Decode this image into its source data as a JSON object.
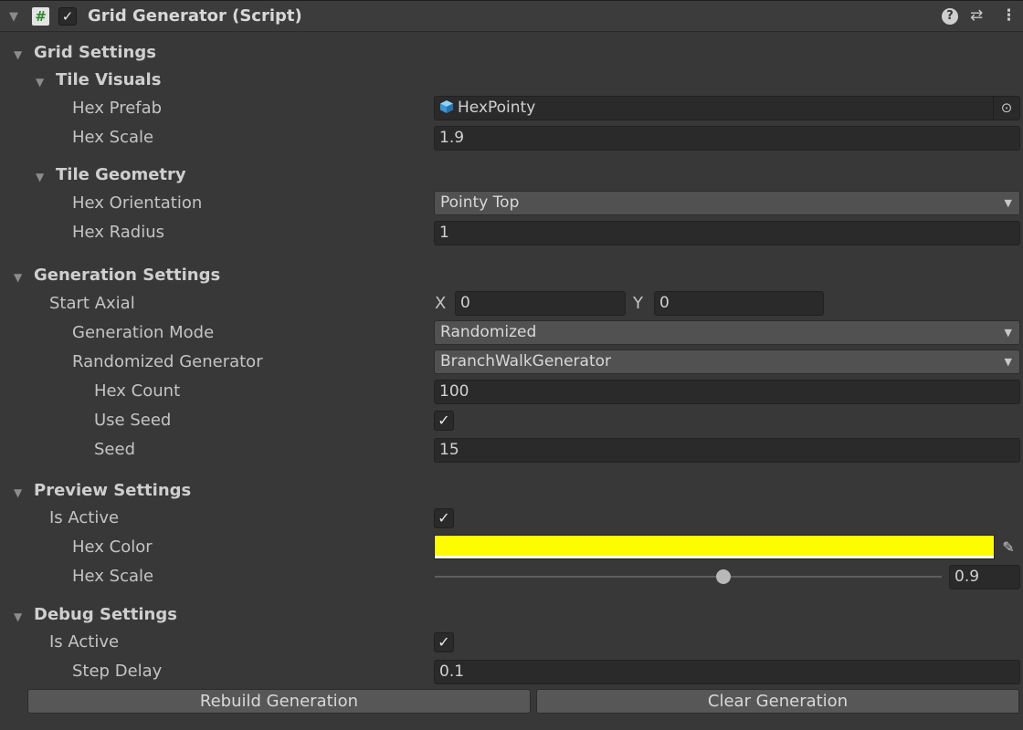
{
  "header": {
    "title": "Grid Generator (Script)",
    "enabled_check": "✓",
    "script_glyph": "#",
    "help_glyph": "?",
    "presets_glyph": "⇄",
    "menu_glyph": "⋮"
  },
  "sections": {
    "grid_settings": "Grid Settings",
    "tile_visuals": "Tile Visuals",
    "tile_geometry": "Tile Geometry",
    "generation_settings": "Generation Settings",
    "preview_settings": "Preview Settings",
    "debug_settings": "Debug Settings"
  },
  "tile_visuals": {
    "hex_prefab_label": "Hex Prefab",
    "hex_prefab_value": "HexPointy",
    "hex_scale_label": "Hex Scale",
    "hex_scale_value": "1.9"
  },
  "tile_geometry": {
    "hex_orientation_label": "Hex Orientation",
    "hex_orientation_value": "Pointy Top",
    "hex_radius_label": "Hex Radius",
    "hex_radius_value": "1"
  },
  "generation": {
    "start_axial_label": "Start Axial",
    "x_label": "X",
    "x_value": "0",
    "y_label": "Y",
    "y_value": "0",
    "generation_mode_label": "Generation Mode",
    "generation_mode_value": "Randomized",
    "randomized_generator_label": "Randomized Generator",
    "randomized_generator_value": "BranchWalkGenerator",
    "hex_count_label": "Hex Count",
    "hex_count_value": "100",
    "use_seed_label": "Use Seed",
    "use_seed_checked": true,
    "seed_label": "Seed",
    "seed_value": "15"
  },
  "preview": {
    "is_active_label": "Is Active",
    "is_active_checked": true,
    "hex_color_label": "Hex Color",
    "hex_color": "#FDFD00",
    "hex_scale_label": "Hex Scale",
    "hex_scale_value": "0.9"
  },
  "debug": {
    "is_active_label": "Is Active",
    "is_active_checked": true,
    "step_delay_label": "Step Delay",
    "step_delay_value": "0.1"
  },
  "buttons": {
    "rebuild": "Rebuild Generation",
    "clear": "Clear Generation"
  },
  "glyphs": {
    "check": "✓",
    "caret": "▼",
    "fold": "▼",
    "picker": "⊙",
    "eyedropper": "✎"
  },
  "colors": {
    "background": "#383838",
    "field": "#2a2a2a",
    "dropdown": "#515151",
    "prefab_icon": "#4aa8e0"
  }
}
